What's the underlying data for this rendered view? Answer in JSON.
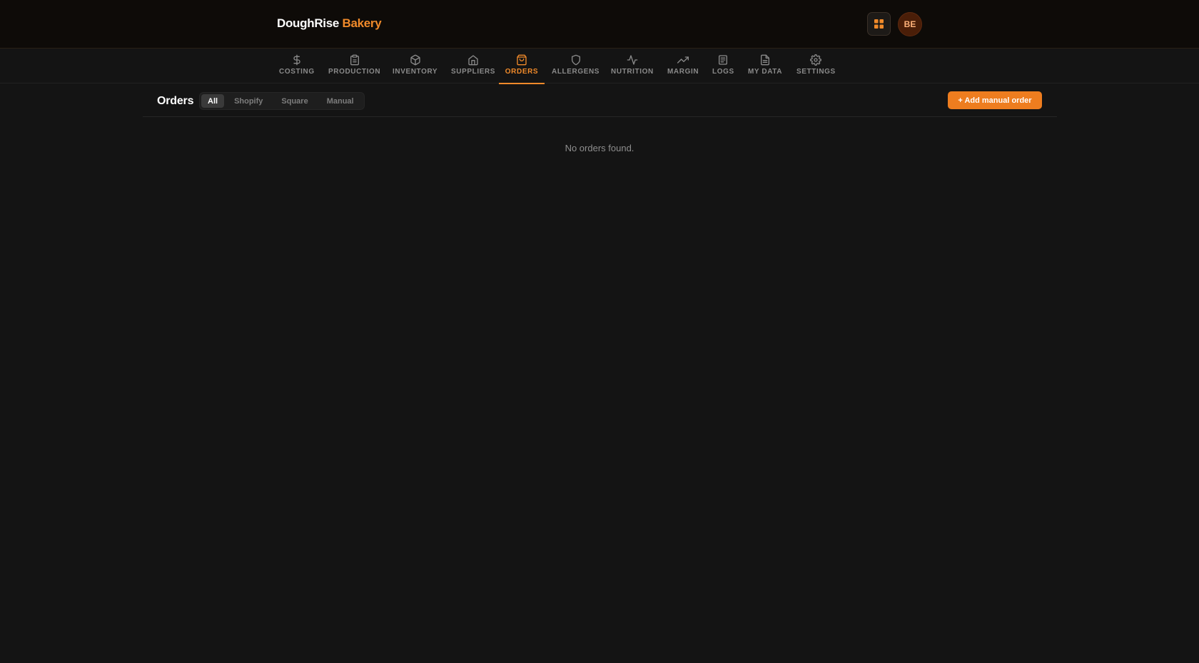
{
  "brand": {
    "name": "DoughRise",
    "accent_word": "Bakery"
  },
  "header": {
    "avatar_initials": "BE",
    "apps_icon": "grid-icon"
  },
  "nav": {
    "items": [
      {
        "label": "COSTING",
        "icon": "dollar-icon"
      },
      {
        "label": "PRODUCTION",
        "icon": "clipboard-icon"
      },
      {
        "label": "INVENTORY",
        "icon": "box-icon"
      },
      {
        "label": "SUPPLIERS",
        "icon": "home-icon"
      },
      {
        "label": "ORDERS",
        "icon": "shopping-bag-icon",
        "active": true
      },
      {
        "label": "ALLERGENS",
        "icon": "shield-icon"
      },
      {
        "label": "NUTRITION",
        "icon": "activity-icon"
      },
      {
        "label": "MARGIN",
        "icon": "trending-up-icon"
      },
      {
        "label": "LOGS",
        "icon": "list-icon"
      },
      {
        "label": "MY DATA",
        "icon": "file-text-icon"
      },
      {
        "label": "SETTINGS",
        "icon": "gear-icon"
      }
    ]
  },
  "page": {
    "title": "Orders",
    "filters": [
      "All",
      "Shopify",
      "Square",
      "Manual"
    ],
    "selected_filter": "All",
    "add_button": "+ Add manual order",
    "empty_message": "No orders found."
  },
  "colors": {
    "accent": "#f08a2a",
    "background": "#141414",
    "header_background": "#0e0b08"
  }
}
